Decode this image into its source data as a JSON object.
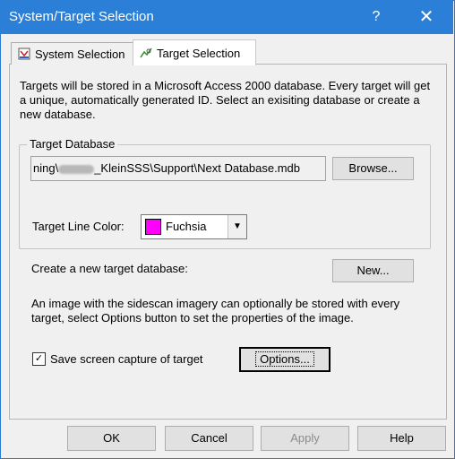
{
  "window": {
    "title": "System/Target Selection",
    "help_glyph": "?",
    "close_glyph": "✕"
  },
  "tabs": [
    {
      "label": "System Selection",
      "icon": "system-icon",
      "selected": false
    },
    {
      "label": "Target Selection",
      "icon": "target-icon",
      "selected": true
    }
  ],
  "intro_text": "Targets will be stored in a Microsoft Access 2000 database. Every target will get a unique, automatically generated ID. Select an exisiting database or create a new database.",
  "target_database": {
    "legend": "Target Database",
    "path_prefix": "ning\\",
    "path_suffix": "_KleinSSS\\Support\\Next Database.mdb",
    "browse_label": "Browse...",
    "line_color_label": "Target Line Color:",
    "line_color_value": "Fuchsia",
    "line_color_hex": "#ff00ff"
  },
  "create_label": "Create a new target database:",
  "new_label": "New...",
  "image_note": "An image with the sidescan imagery can optionally be stored with every target, select Options button to set the properties of the image.",
  "save_capture": {
    "label": "Save screen capture of target",
    "checked": true
  },
  "options_label": "Options...",
  "footer": {
    "ok": "OK",
    "cancel": "Cancel",
    "apply": "Apply",
    "help": "Help"
  },
  "colors": {
    "titlebar": "#2b7fd6",
    "dialog_bg": "#f0f0f0"
  }
}
